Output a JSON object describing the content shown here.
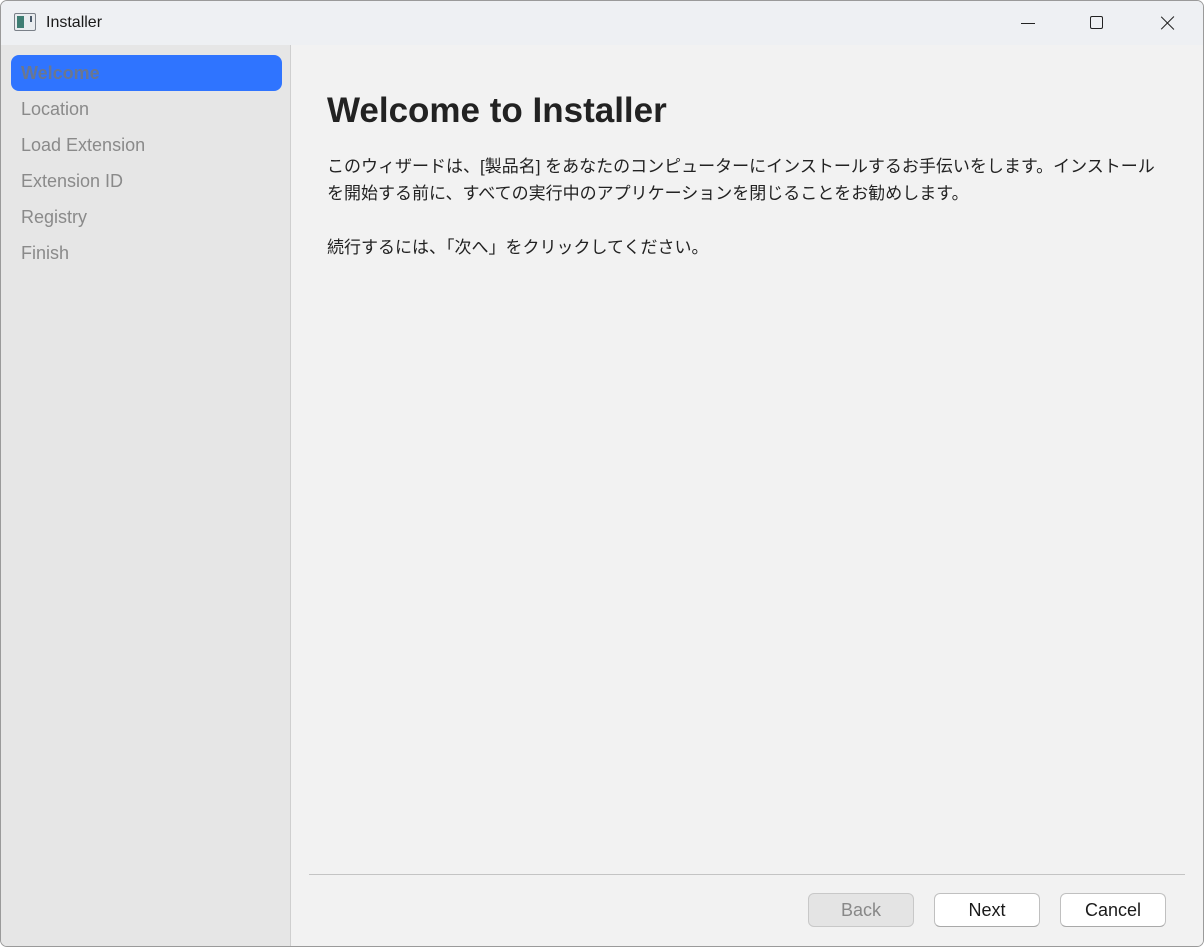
{
  "window": {
    "title": "Installer"
  },
  "sidebar": {
    "items": [
      {
        "label": "Welcome",
        "active": true
      },
      {
        "label": "Location",
        "active": false
      },
      {
        "label": "Load Extension",
        "active": false
      },
      {
        "label": "Extension ID",
        "active": false
      },
      {
        "label": "Registry",
        "active": false
      },
      {
        "label": "Finish",
        "active": false
      }
    ]
  },
  "main": {
    "heading": "Welcome to Installer",
    "paragraph1": "このウィザードは、[製品名] をあなたのコンピューターにインストールするお手伝いをします。インストールを開始する前に、すべての実行中のアプリケーションを閉じることをお勧めします。",
    "paragraph2": "続行するには、「次へ」をクリックしてください。"
  },
  "footer": {
    "back_label": "Back",
    "next_label": "Next",
    "cancel_label": "Cancel"
  },
  "colors": {
    "accent": "#2f74ff",
    "sidebar_bg": "#e6e6e6",
    "content_bg": "#f2f2f2"
  },
  "icons": {
    "app": "installer-app-icon",
    "minimize": "minimize-icon",
    "maximize": "maximize-icon",
    "close": "close-icon"
  }
}
